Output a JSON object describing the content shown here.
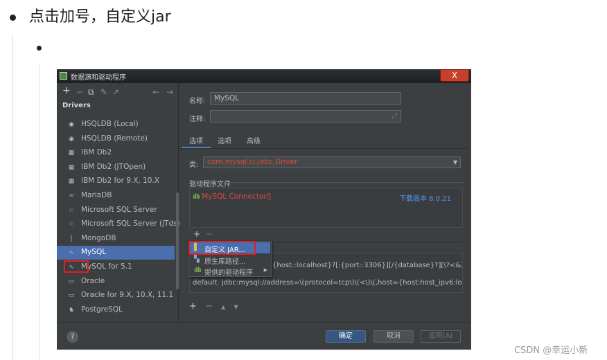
{
  "page": {
    "heading": "点击加号，自定义jar",
    "watermark": "CSDN @幸运小新"
  },
  "dialog": {
    "title": "数据源和驱动程序",
    "close_label": "X",
    "toolbar": {
      "add": "+",
      "remove": "−",
      "copy": "⧉",
      "edit": "✎",
      "export": "↗",
      "back": "←",
      "forward": "→"
    },
    "drivers_title": "Drivers",
    "drivers": [
      {
        "label": "HSQLDB (Local)",
        "icon": "◉"
      },
      {
        "label": "HSQLDB (Remote)",
        "icon": "◉"
      },
      {
        "label": "IBM Db2",
        "icon": "▦"
      },
      {
        "label": "IBM Db2 (JTOpen)",
        "icon": "▦"
      },
      {
        "label": "IBM Db2 for 9.X, 10.X",
        "icon": "▦"
      },
      {
        "label": "MariaDB",
        "icon": "≈"
      },
      {
        "label": "Microsoft SQL Server",
        "icon": "♘"
      },
      {
        "label": "Microsoft SQL Server (jTds)",
        "icon": "♘"
      },
      {
        "label": "MongoDB",
        "icon": "❘"
      },
      {
        "label": "MySQL",
        "icon": "∿"
      },
      {
        "label": "MySQL for 5.1",
        "icon": "∿"
      },
      {
        "label": "Oracle",
        "icon": "▭"
      },
      {
        "label": "Oracle for 9.X, 10.X, 11.1",
        "icon": "▭"
      },
      {
        "label": "PostgreSQL",
        "icon": "♞"
      }
    ],
    "selected_driver": "MySQL",
    "name_label": "名称:",
    "name_value": "MySQL",
    "comment_label": "注释:",
    "comment_expand": "⤢",
    "tabs": [
      "选项",
      "选项",
      "高级"
    ],
    "class_label": "类:",
    "class_value": "com.mysql.cj.jdbc.Driver",
    "driver_files_label": "驱动程序文件",
    "driver_file": "MySQL Connector/J",
    "download_link": "下载版本 8.0.21",
    "files_add": "+",
    "files_remove": "−",
    "popup": [
      {
        "label": "自定义 JAR...",
        "icon": "▌"
      },
      {
        "label": "原生库路径...",
        "icon": "▚"
      },
      {
        "label": "提供的驱动程序",
        "icon": "▮"
      }
    ],
    "url_rows": [
      {
        "type": "",
        "template": "{host::localhost}?[:{port::3306}][/{database}?][\\?<&,user=..."
      },
      {
        "type": "default",
        "template": "jdbc:mysql://address=\\(protocol=tcp\\)\\(<\\)\\(,host={host:host_ipv6:loc..."
      }
    ],
    "url_toolbar": [
      "+",
      "−",
      "▲",
      "▼"
    ],
    "buttons": {
      "help": "?",
      "ok": "确定",
      "cancel": "取消",
      "apply": "应用(A)"
    }
  }
}
